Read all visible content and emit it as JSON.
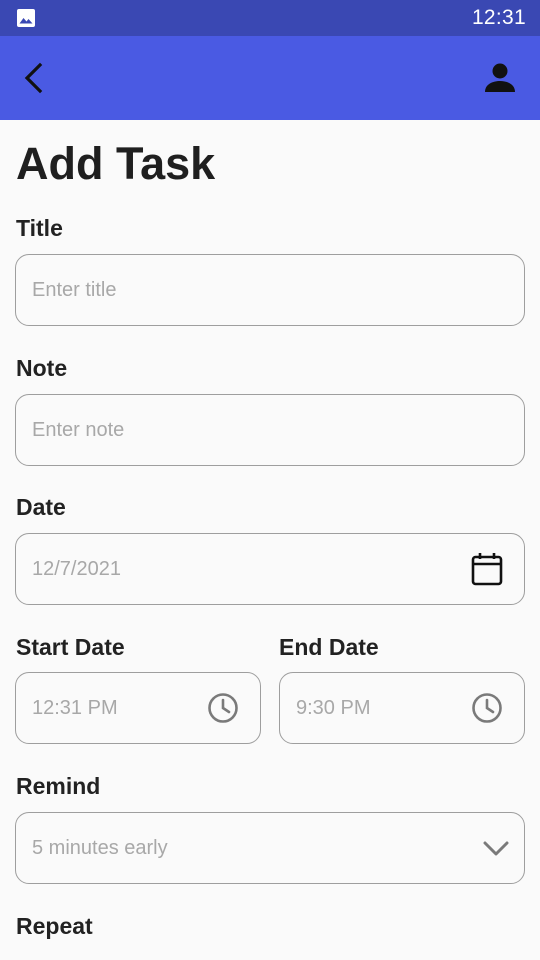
{
  "status_bar": {
    "notification_icon": "image-icon",
    "time": "12:31"
  },
  "app_bar": {
    "back_icon": "chevron-left-icon",
    "profile_icon": "person-icon"
  },
  "page": {
    "title": "Add Task"
  },
  "form": {
    "title": {
      "label": "Title",
      "placeholder": "Enter title",
      "value": ""
    },
    "note": {
      "label": "Note",
      "placeholder": "Enter note",
      "value": ""
    },
    "date": {
      "label": "Date",
      "value": "12/7/2021",
      "icon": "calendar-icon"
    },
    "start_date": {
      "label": "Start Date",
      "value": "12:31 PM",
      "icon": "clock-icon"
    },
    "end_date": {
      "label": "End Date",
      "value": "9:30 PM",
      "icon": "clock-icon"
    },
    "remind": {
      "label": "Remind",
      "value": "5 minutes early",
      "icon": "chevron-down-icon"
    },
    "repeat": {
      "label": "Repeat"
    }
  },
  "colors": {
    "status_bar": "#3a48b3",
    "app_bar": "#4a5ae3",
    "background": "#fafafa",
    "field_border": "#9e9e9e",
    "placeholder_text": "#a8a8a8"
  }
}
